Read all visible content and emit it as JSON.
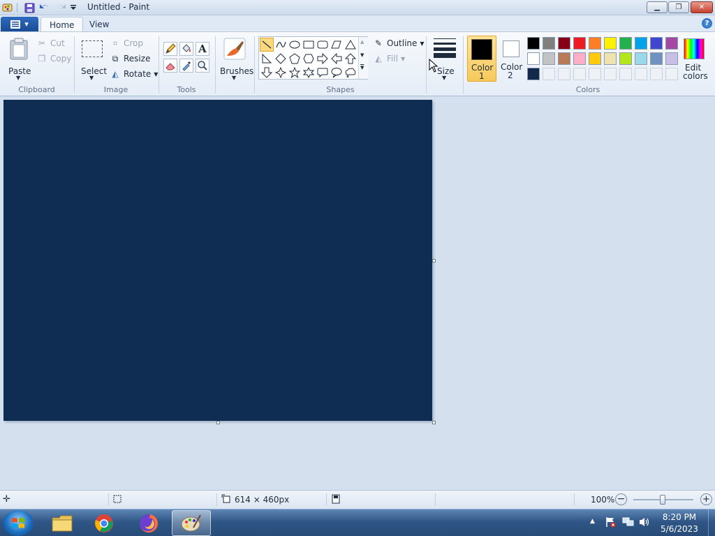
{
  "window": {
    "title": "Untitled - Paint",
    "minimize_glyph": "▁",
    "maximize_glyph": "❐",
    "close_glyph": "✕"
  },
  "tabs": {
    "app_menu_glyph": "▾",
    "home": "Home",
    "view": "View",
    "help_glyph": "?"
  },
  "clipboard": {
    "paste": "Paste",
    "cut": "Cut",
    "copy": "Copy",
    "label": "Clipboard"
  },
  "image": {
    "select": "Select",
    "crop": "Crop",
    "resize": "Resize",
    "rotate": "Rotate",
    "label": "Image"
  },
  "tools": {
    "label": "Tools",
    "text_glyph": "A"
  },
  "brushes": {
    "label": "Brushes"
  },
  "shapes": {
    "outline": "Outline",
    "fill": "Fill",
    "label": "Shapes",
    "size": "Size"
  },
  "colors": {
    "color1_line1": "Color",
    "color1_line2": "1",
    "color2_line1": "Color",
    "color2_line2": "2",
    "edit_line1": "Edit",
    "edit_line2": "colors",
    "label": "Colors",
    "color1_value": "#000000",
    "color2_value": "#ffffff",
    "palette_row1": [
      "#000000",
      "#7f7f7f",
      "#880015",
      "#ed1c24",
      "#ff7f27",
      "#fff200",
      "#22b14c",
      "#00a2e8",
      "#3f48cc",
      "#a349a4"
    ],
    "palette_row2": [
      "#ffffff",
      "#c3c3c3",
      "#b97a57",
      "#ffaec9",
      "#ffc90e",
      "#efe4b0",
      "#b5e61d",
      "#99d9ea",
      "#7092be",
      "#c8bfe7"
    ],
    "palette_row3": [
      "#13294b"
    ]
  },
  "canvas": {
    "color": "#0f2d52"
  },
  "status": {
    "dimensions": "614 × 460px",
    "zoom": "100%"
  },
  "taskbar": {
    "time": "8:20 PM",
    "date": "5/6/2023"
  }
}
